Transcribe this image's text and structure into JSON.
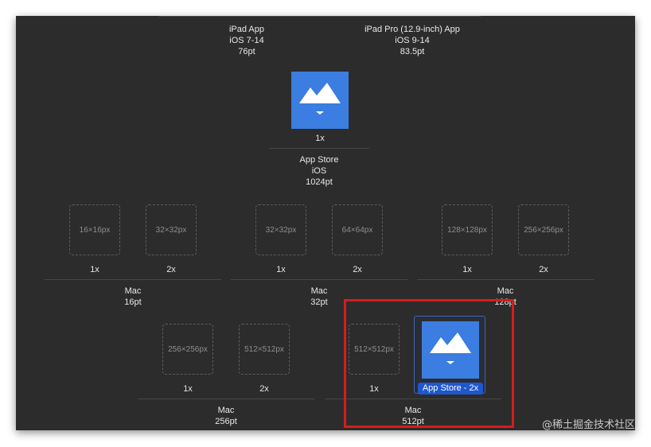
{
  "top_groups": [
    {
      "name": "iPad App",
      "os": "iOS 7-14",
      "size": "76pt"
    },
    {
      "name": "iPad Pro (12.9-inch) App",
      "os": "iOS 9-14",
      "size": "83.5pt"
    }
  ],
  "app_store": {
    "scale": "1x",
    "name": "App Store",
    "os": "iOS",
    "size": "1024pt"
  },
  "mac_row1": [
    {
      "slots": [
        "16×16px",
        "32×32px"
      ],
      "scales": [
        "1x",
        "2x"
      ],
      "name": "Mac",
      "size": "16pt"
    },
    {
      "slots": [
        "32×32px",
        "64×64px"
      ],
      "scales": [
        "1x",
        "2x"
      ],
      "name": "Mac",
      "size": "32pt"
    },
    {
      "slots": [
        "128×128px",
        "256×256px"
      ],
      "scales": [
        "1x",
        "2x"
      ],
      "name": "Mac",
      "size": "128pt"
    }
  ],
  "mac_row2": [
    {
      "slots": [
        "256×256px",
        "512×512px"
      ],
      "scales": [
        "1x",
        "2x"
      ],
      "name": "Mac",
      "size": "256pt"
    },
    {
      "slots": [
        "512×512px"
      ],
      "scales": [
        "1x"
      ],
      "selected_label": "App Store - 2x",
      "name": "Mac",
      "size": "512pt"
    }
  ],
  "colors": {
    "icon_blue": "#3b7de0",
    "selection_blue": "#1f57cf",
    "highlight_red": "#d71c1c",
    "background": "#2c2c2c"
  },
  "watermark": "@稀土掘金技术社区"
}
